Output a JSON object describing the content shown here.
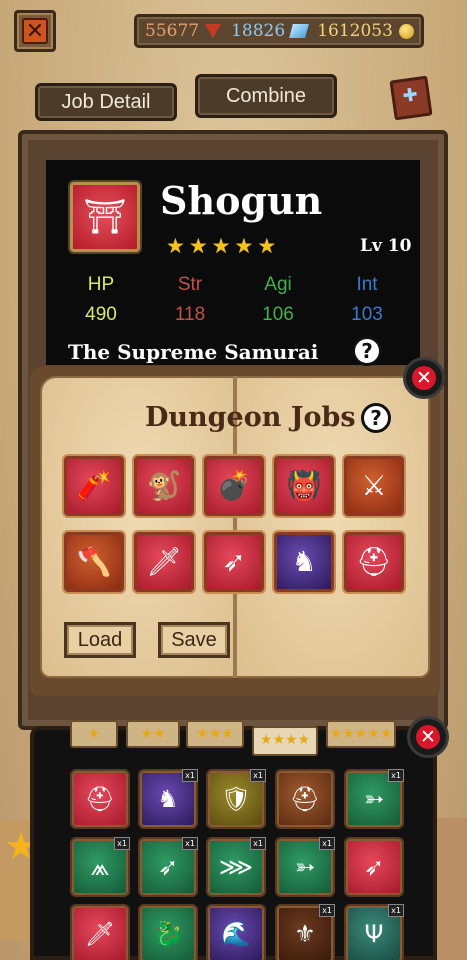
{
  "header": {
    "close_glyph": "✕",
    "currency": {
      "red_gems": "55677",
      "blue_crystals": "18826",
      "gold": "1612053"
    },
    "tabs": [
      {
        "label": "Job Detail",
        "active": true
      },
      {
        "label": "Combine",
        "active": false
      }
    ],
    "book_icon": "spellbook-icon"
  },
  "hero": {
    "name": "Shogun",
    "stars": 5,
    "level": "Lv 10",
    "title": "The Supreme Samurai",
    "stats": [
      {
        "label": "HP",
        "value": "490",
        "color": "#d9e86a"
      },
      {
        "label": "Str",
        "value": "118",
        "color": "#c0504a"
      },
      {
        "label": "Agi",
        "value": "106",
        "color": "#3fb04a"
      },
      {
        "label": "Int",
        "value": "103",
        "color": "#3a7ac8"
      }
    ],
    "help_glyph": "?"
  },
  "dungeon_jobs": {
    "title": "Dungeon Jobs",
    "help_glyph": "?",
    "close_glyph": "✕",
    "slots": [
      {
        "icon": "dynamite-icon",
        "glyph": "🧨",
        "color": "red"
      },
      {
        "icon": "monkey-rose-icon",
        "glyph": "🐒",
        "color": "red"
      },
      {
        "icon": "bomb-icon",
        "glyph": "💣",
        "color": "red"
      },
      {
        "icon": "demon-icon",
        "glyph": "👹",
        "color": "red"
      },
      {
        "icon": "crossed-swords-icon",
        "glyph": "⚔",
        "color": "orange"
      },
      {
        "icon": "viking-icon",
        "glyph": "🪓",
        "color": "orange"
      },
      {
        "icon": "sword-icon",
        "glyph": "🗡",
        "color": "red"
      },
      {
        "icon": "spear-icon",
        "glyph": "➶",
        "color": "red"
      },
      {
        "icon": "dark-knight-icon",
        "glyph": "♞",
        "color": "purple"
      },
      {
        "icon": "spartan-helmet-icon",
        "glyph": "⛑",
        "color": "red"
      }
    ],
    "load_label": "Load",
    "save_label": "Save"
  },
  "inventory": {
    "close_glyph": "✕",
    "tiers": [
      {
        "label": "★",
        "active": false
      },
      {
        "label": "★★",
        "active": false
      },
      {
        "label": "★★★",
        "active": false
      },
      {
        "label": "★★★★",
        "active": true
      },
      {
        "label": "★★★★★",
        "active": false
      }
    ],
    "items": [
      {
        "icon": "helmet-icon",
        "glyph": "⛑",
        "color": "red",
        "qty": ""
      },
      {
        "icon": "dark-knight-icon",
        "glyph": "♞",
        "color": "purple",
        "qty": "x1"
      },
      {
        "icon": "shield-icon",
        "glyph": "🛡",
        "color": "olive",
        "qty": "x1"
      },
      {
        "icon": "spartan-helmet-icon",
        "glyph": "⛑",
        "color": "brown",
        "qty": ""
      },
      {
        "icon": "wind-arrow-icon",
        "glyph": "➳",
        "color": "green",
        "qty": "x1"
      },
      {
        "icon": "dragon-claw-icon",
        "glyph": "⩕",
        "color": "green",
        "qty": "x1"
      },
      {
        "icon": "arrow-icon",
        "glyph": "➶",
        "color": "green",
        "qty": "x1"
      },
      {
        "icon": "triple-claw-icon",
        "glyph": "⋙",
        "color": "green",
        "qty": "x1"
      },
      {
        "icon": "wind-arrow-icon",
        "glyph": "➳",
        "color": "green",
        "qty": "x1"
      },
      {
        "icon": "spear-icon",
        "glyph": "➶",
        "color": "red",
        "qty": ""
      },
      {
        "icon": "sword-icon",
        "glyph": "🗡",
        "color": "red",
        "qty": ""
      },
      {
        "icon": "dragon-icon",
        "glyph": "🐉",
        "color": "green",
        "qty": ""
      },
      {
        "icon": "wave-icon",
        "glyph": "🌊",
        "color": "purple",
        "qty": ""
      },
      {
        "icon": "winged-sword-icon",
        "glyph": "⚜",
        "color": "dark-brown",
        "qty": "x1"
      },
      {
        "icon": "trident-icon",
        "glyph": "Ψ",
        "color": "teal",
        "qty": "x1"
      }
    ]
  }
}
